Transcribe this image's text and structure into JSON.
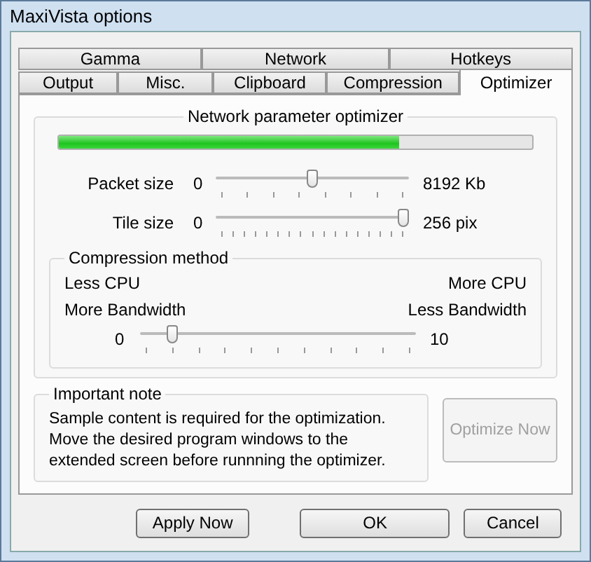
{
  "window": {
    "title": "MaxiVista options"
  },
  "tab_rows": [
    {
      "tabs": [
        {
          "label": "Gamma",
          "selected": false
        },
        {
          "label": "Network",
          "selected": false
        },
        {
          "label": "Hotkeys",
          "selected": false
        }
      ]
    },
    {
      "tabs": [
        {
          "label": "Output",
          "selected": false
        },
        {
          "label": "Misc.",
          "selected": false
        },
        {
          "label": "Clipboard",
          "selected": false
        },
        {
          "label": "Compression",
          "selected": false
        },
        {
          "label": "Optimizer",
          "selected": true
        }
      ]
    }
  ],
  "optimizer": {
    "title": "Network parameter optimizer",
    "progress": {
      "level": 0.72
    },
    "sliders": [
      {
        "label": "Packet size",
        "min": "0",
        "max": "8192 Kb",
        "level": 0.5
      },
      {
        "label": "Tile size",
        "min": "0",
        "max": "256 pix",
        "level": 1
      }
    ]
  },
  "compression": {
    "title": "Compression method",
    "left_lines": [
      "Less CPU",
      "More Bandwidth"
    ],
    "right_lines": [
      "More CPU",
      "Less Bandwidth"
    ],
    "slider": {
      "min": "0",
      "max": "10",
      "level": 0.1
    }
  },
  "note": {
    "title": "Important note",
    "text": "Sample content is required for the optimization. Move the desired program windows to the extended screen before runnning the optimizer."
  },
  "optimize_button": {
    "label": "Optimize Now",
    "disabled": true
  },
  "buttons": [
    {
      "label": "Apply Now"
    },
    {
      "label": "OK"
    },
    {
      "label": "Cancel"
    }
  ]
}
